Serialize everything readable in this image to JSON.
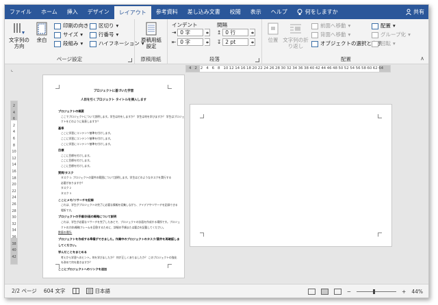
{
  "ribbon_tabs": [
    {
      "label": "ファイル"
    },
    {
      "label": "ホーム"
    },
    {
      "label": "挿入"
    },
    {
      "label": "デザイン"
    },
    {
      "label": "レイアウト"
    },
    {
      "label": "参考資料"
    },
    {
      "label": "差し込み文書"
    },
    {
      "label": "校閲"
    },
    {
      "label": "表示"
    },
    {
      "label": "ヘルプ"
    }
  ],
  "tell_me": "何をしますか",
  "share": "共有",
  "page_setup": {
    "text_direction": "文字列の方向",
    "margins": "余白",
    "orientation": "印刷の向き",
    "size": "サイズ",
    "columns": "段組み",
    "breaks": "区切り",
    "line_numbers": "行番号",
    "hyphenation": "ハイフネーション",
    "group_label": "ページ設定"
  },
  "genko": {
    "button": "原稿用紙設定",
    "group_label": "原稿用紙"
  },
  "paragraph": {
    "indent_header": "インデント",
    "spacing_header": "間隔",
    "indent_left": "0 字",
    "indent_right": "0 字",
    "spacing_before": "0 行",
    "spacing_after": "2 pt",
    "group_label": "段落"
  },
  "arrange": {
    "position": "位置",
    "wrap_text": "文字列の折り返し",
    "bring_forward": "前面へ移動",
    "send_backward": "背面へ移動",
    "selection_pane": "オブジェクトの選択と表示",
    "align": "配置",
    "group": "グループ化",
    "rotate": "回転",
    "group_label": "配置"
  },
  "ruler": {
    "ticks": [
      "4",
      "2",
      "2",
      "4",
      "6",
      "8",
      "10",
      "12",
      "14",
      "16",
      "18",
      "20",
      "22",
      "24",
      "26",
      "28",
      "30",
      "32",
      "34",
      "36",
      "38",
      "40",
      "42",
      "44",
      "46",
      "48",
      "50",
      "52",
      "54",
      "56",
      "58",
      "60",
      "62",
      "64"
    ],
    "vticks": [
      "2",
      "4",
      "6",
      "2",
      "4",
      "6",
      "8",
      "10",
      "12",
      "14",
      "16",
      "18",
      "20",
      "22",
      "24",
      "26",
      "28",
      "30",
      "32",
      "34",
      "36",
      "38",
      "40",
      "42"
    ]
  },
  "document": {
    "title": "プロジェクトに基づいた学習",
    "subtitle": "人目を引くプロジェクト タイトルを挿入します",
    "lines": [
      {
        "text": "プロジェクトの概要",
        "style": "h"
      },
      {
        "text": "ここでプロジェクトについて説明します。学生は何をしますか？ 学生は何を学びますか？ 学生はプロジェ",
        "style": "b"
      },
      {
        "text": "クトをどのように発表しますか？",
        "style": "b"
      },
      {
        "text": "基準",
        "style": "h"
      },
      {
        "text": "ここに学習にコンテンツ基準を付けします。",
        "style": "b"
      },
      {
        "text": "ここに学習にコンテンツ基準を付けします。",
        "style": "b"
      },
      {
        "text": "ここに学習にコンテンツ基準を付けします。",
        "style": "b"
      },
      {
        "text": "目標",
        "style": "h"
      },
      {
        "text": "ここに目標を付けします。",
        "style": "b"
      },
      {
        "text": "ここに目標を付けします。",
        "style": "b"
      },
      {
        "text": "ここに目標を付けします。",
        "style": "b"
      },
      {
        "text": "質問/タスク",
        "style": "h"
      },
      {
        "text": "タスク 1: プロジェクトの要件の範囲について説明します。学生はどのようなタスクを実行する",
        "style": "b"
      },
      {
        "text": "必要がありますか？",
        "style": "b"
      },
      {
        "text": "タスク 2",
        "style": "b"
      },
      {
        "text": "タスク 3",
        "style": "b"
      },
      {
        "text": "ここにメモ/リサーチを記録",
        "style": "h"
      },
      {
        "text": "これは、学生がプロジェクトの完了に必要な情報を収集しながら、アイデアやリサーチを記録できる",
        "style": "b"
      },
      {
        "text": "場所です。",
        "style": "b"
      },
      {
        "text": "プロジェクトの手順/計画の概略について説明",
        "style": "h"
      },
      {
        "text": "これは、学生が必要なリサーチを完了したあとで、プロジェクトの計画を作成する場所です。プロジェ",
        "style": "b"
      },
      {
        "text": "クトの大枠/概略フレームを回答するために、詳細の手順または要点を記載してください。",
        "style": "b"
      },
      {
        "text": "数値の場所:",
        "style": "u"
      },
      {
        "text": "プロジェクトを作成する準備ができました。作業中のプロジェクトのタスク/要件を再確認しま",
        "style": "h"
      },
      {
        "text": "してください。",
        "style": "h"
      },
      {
        "text": "学んだことをまとめる",
        "style": "h"
      },
      {
        "text": "考えから学習へのヒント。何を学びましたか？ 何が正しくありましたか？ このプロジェクトの強化",
        "style": "b"
      },
      {
        "text": "を改めて何を書きますか？",
        "style": "b"
      },
      {
        "text": "ここにプロジェクトへのリンクを追加",
        "style": "h"
      }
    ]
  },
  "status": {
    "page": "2/2 ページ",
    "words": "604 文字",
    "language": "日本語",
    "zoom": "44%",
    "zoom_minus": "−",
    "zoom_plus": "+",
    "zoom_level_fraction": 0.44
  },
  "colors": {
    "tabbar": "#2b579a",
    "ribbon": "#f3f3f3",
    "canvas": "#e6e6e6"
  }
}
